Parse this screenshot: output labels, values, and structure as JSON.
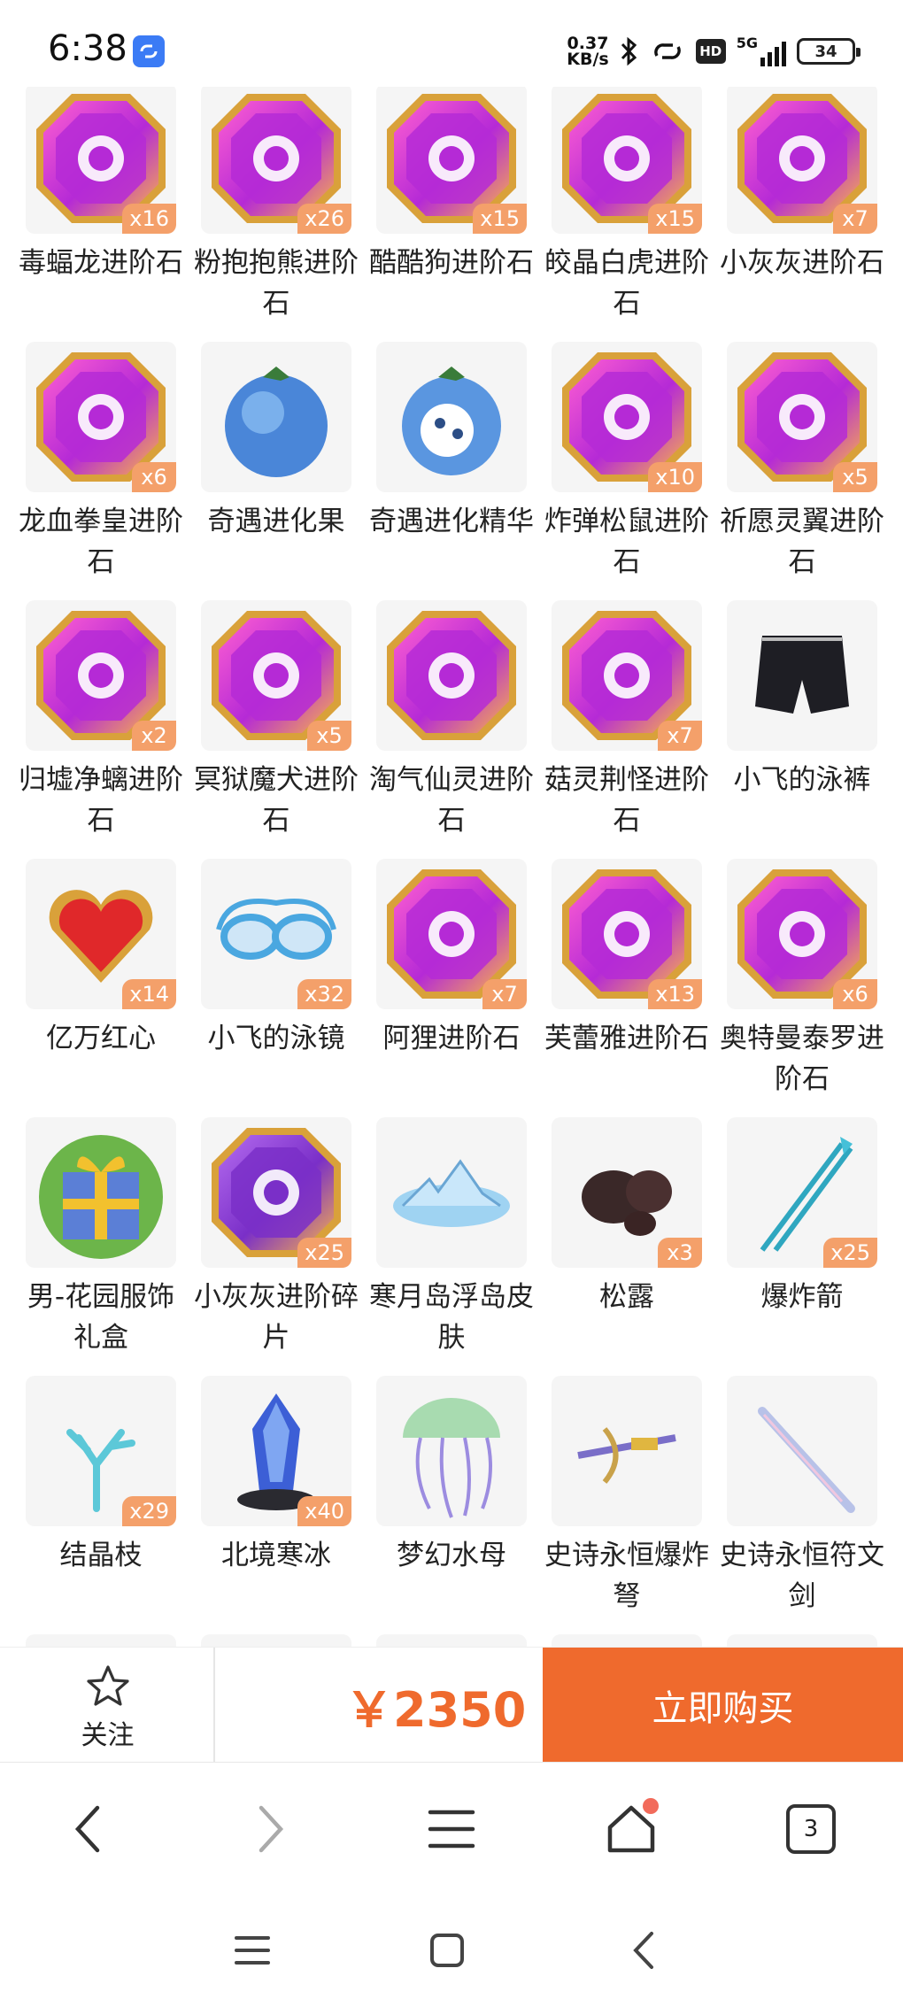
{
  "status_bar": {
    "time": "6:38",
    "net_speed_value": "0.37",
    "net_speed_unit": "KB/s",
    "hd_label": "HD",
    "network": "5G",
    "battery": "34"
  },
  "items": [
    {
      "label": "毒蝠龙进阶石",
      "qty": "x16",
      "icon": "purple-gem-icon"
    },
    {
      "label": "粉抱抱熊进阶石",
      "qty": "x26",
      "icon": "purple-gem-icon"
    },
    {
      "label": "酷酷狗进阶石",
      "qty": "x15",
      "icon": "purple-gem-icon"
    },
    {
      "label": "皎晶白虎进阶石",
      "qty": "x15",
      "icon": "purple-gem-icon"
    },
    {
      "label": "小灰灰进阶石",
      "qty": "x7",
      "icon": "purple-gem-icon"
    },
    {
      "label": "龙血拳皇进阶石",
      "qty": "x6",
      "icon": "purple-gem-icon"
    },
    {
      "label": "奇遇进化果",
      "qty": "",
      "icon": "blue-fruit-icon"
    },
    {
      "label": "奇遇进化精华",
      "qty": "",
      "icon": "blue-fruit-essence-icon"
    },
    {
      "label": "炸弹松鼠进阶石",
      "qty": "x10",
      "icon": "purple-gem-icon"
    },
    {
      "label": "祈愿灵翼进阶石",
      "qty": "x5",
      "icon": "purple-gem-icon"
    },
    {
      "label": "归墟净螭进阶石",
      "qty": "x2",
      "icon": "purple-gem-icon"
    },
    {
      "label": "冥狱魔犬进阶石",
      "qty": "x5",
      "icon": "purple-gem-icon"
    },
    {
      "label": "淘气仙灵进阶石",
      "qty": "",
      "icon": "purple-gem-icon"
    },
    {
      "label": "菇灵荆怪进阶石",
      "qty": "x7",
      "icon": "purple-gem-icon"
    },
    {
      "label": "小飞的泳裤",
      "qty": "",
      "icon": "swim-trunks-icon"
    },
    {
      "label": "亿万红心",
      "qty": "x14",
      "icon": "red-heart-icon"
    },
    {
      "label": "小飞的泳镜",
      "qty": "x32",
      "icon": "goggles-icon"
    },
    {
      "label": "阿狸进阶石",
      "qty": "x7",
      "icon": "purple-gem-icon"
    },
    {
      "label": "芙蕾雅进阶石",
      "qty": "x13",
      "icon": "purple-gem-icon"
    },
    {
      "label": "奥特曼泰罗进阶石",
      "qty": "x6",
      "icon": "purple-gem-icon"
    },
    {
      "label": "男-花园服饰礼盒",
      "qty": "",
      "icon": "gift-box-icon"
    },
    {
      "label": "小灰灰进阶碎片",
      "qty": "x25",
      "icon": "violet-gem-icon"
    },
    {
      "label": "寒月岛浮岛皮肤",
      "qty": "",
      "icon": "floating-island-icon"
    },
    {
      "label": "松露",
      "qty": "x3",
      "icon": "truffle-icon"
    },
    {
      "label": "爆炸箭",
      "qty": "x25",
      "icon": "arrows-icon"
    },
    {
      "label": "结晶枝",
      "qty": "x29",
      "icon": "crystal-branch-icon"
    },
    {
      "label": "北境寒冰",
      "qty": "x40",
      "icon": "ice-crystal-icon"
    },
    {
      "label": "梦幻水母",
      "qty": "",
      "icon": "jellyfish-icon"
    },
    {
      "label": "史诗永恒爆炸弩",
      "qty": "",
      "icon": "crossbow-icon"
    },
    {
      "label": "史诗永恒符文剑",
      "qty": "",
      "icon": "sword-icon"
    }
  ],
  "action_bar": {
    "follow_label": "关注",
    "price": "￥2350",
    "buy_label": "立即购买"
  },
  "browser_nav": {
    "tab_count": "3"
  },
  "colors": {
    "accent": "#ef6a2d",
    "badge": "#f4a06a",
    "notification": "#f26b5b"
  }
}
